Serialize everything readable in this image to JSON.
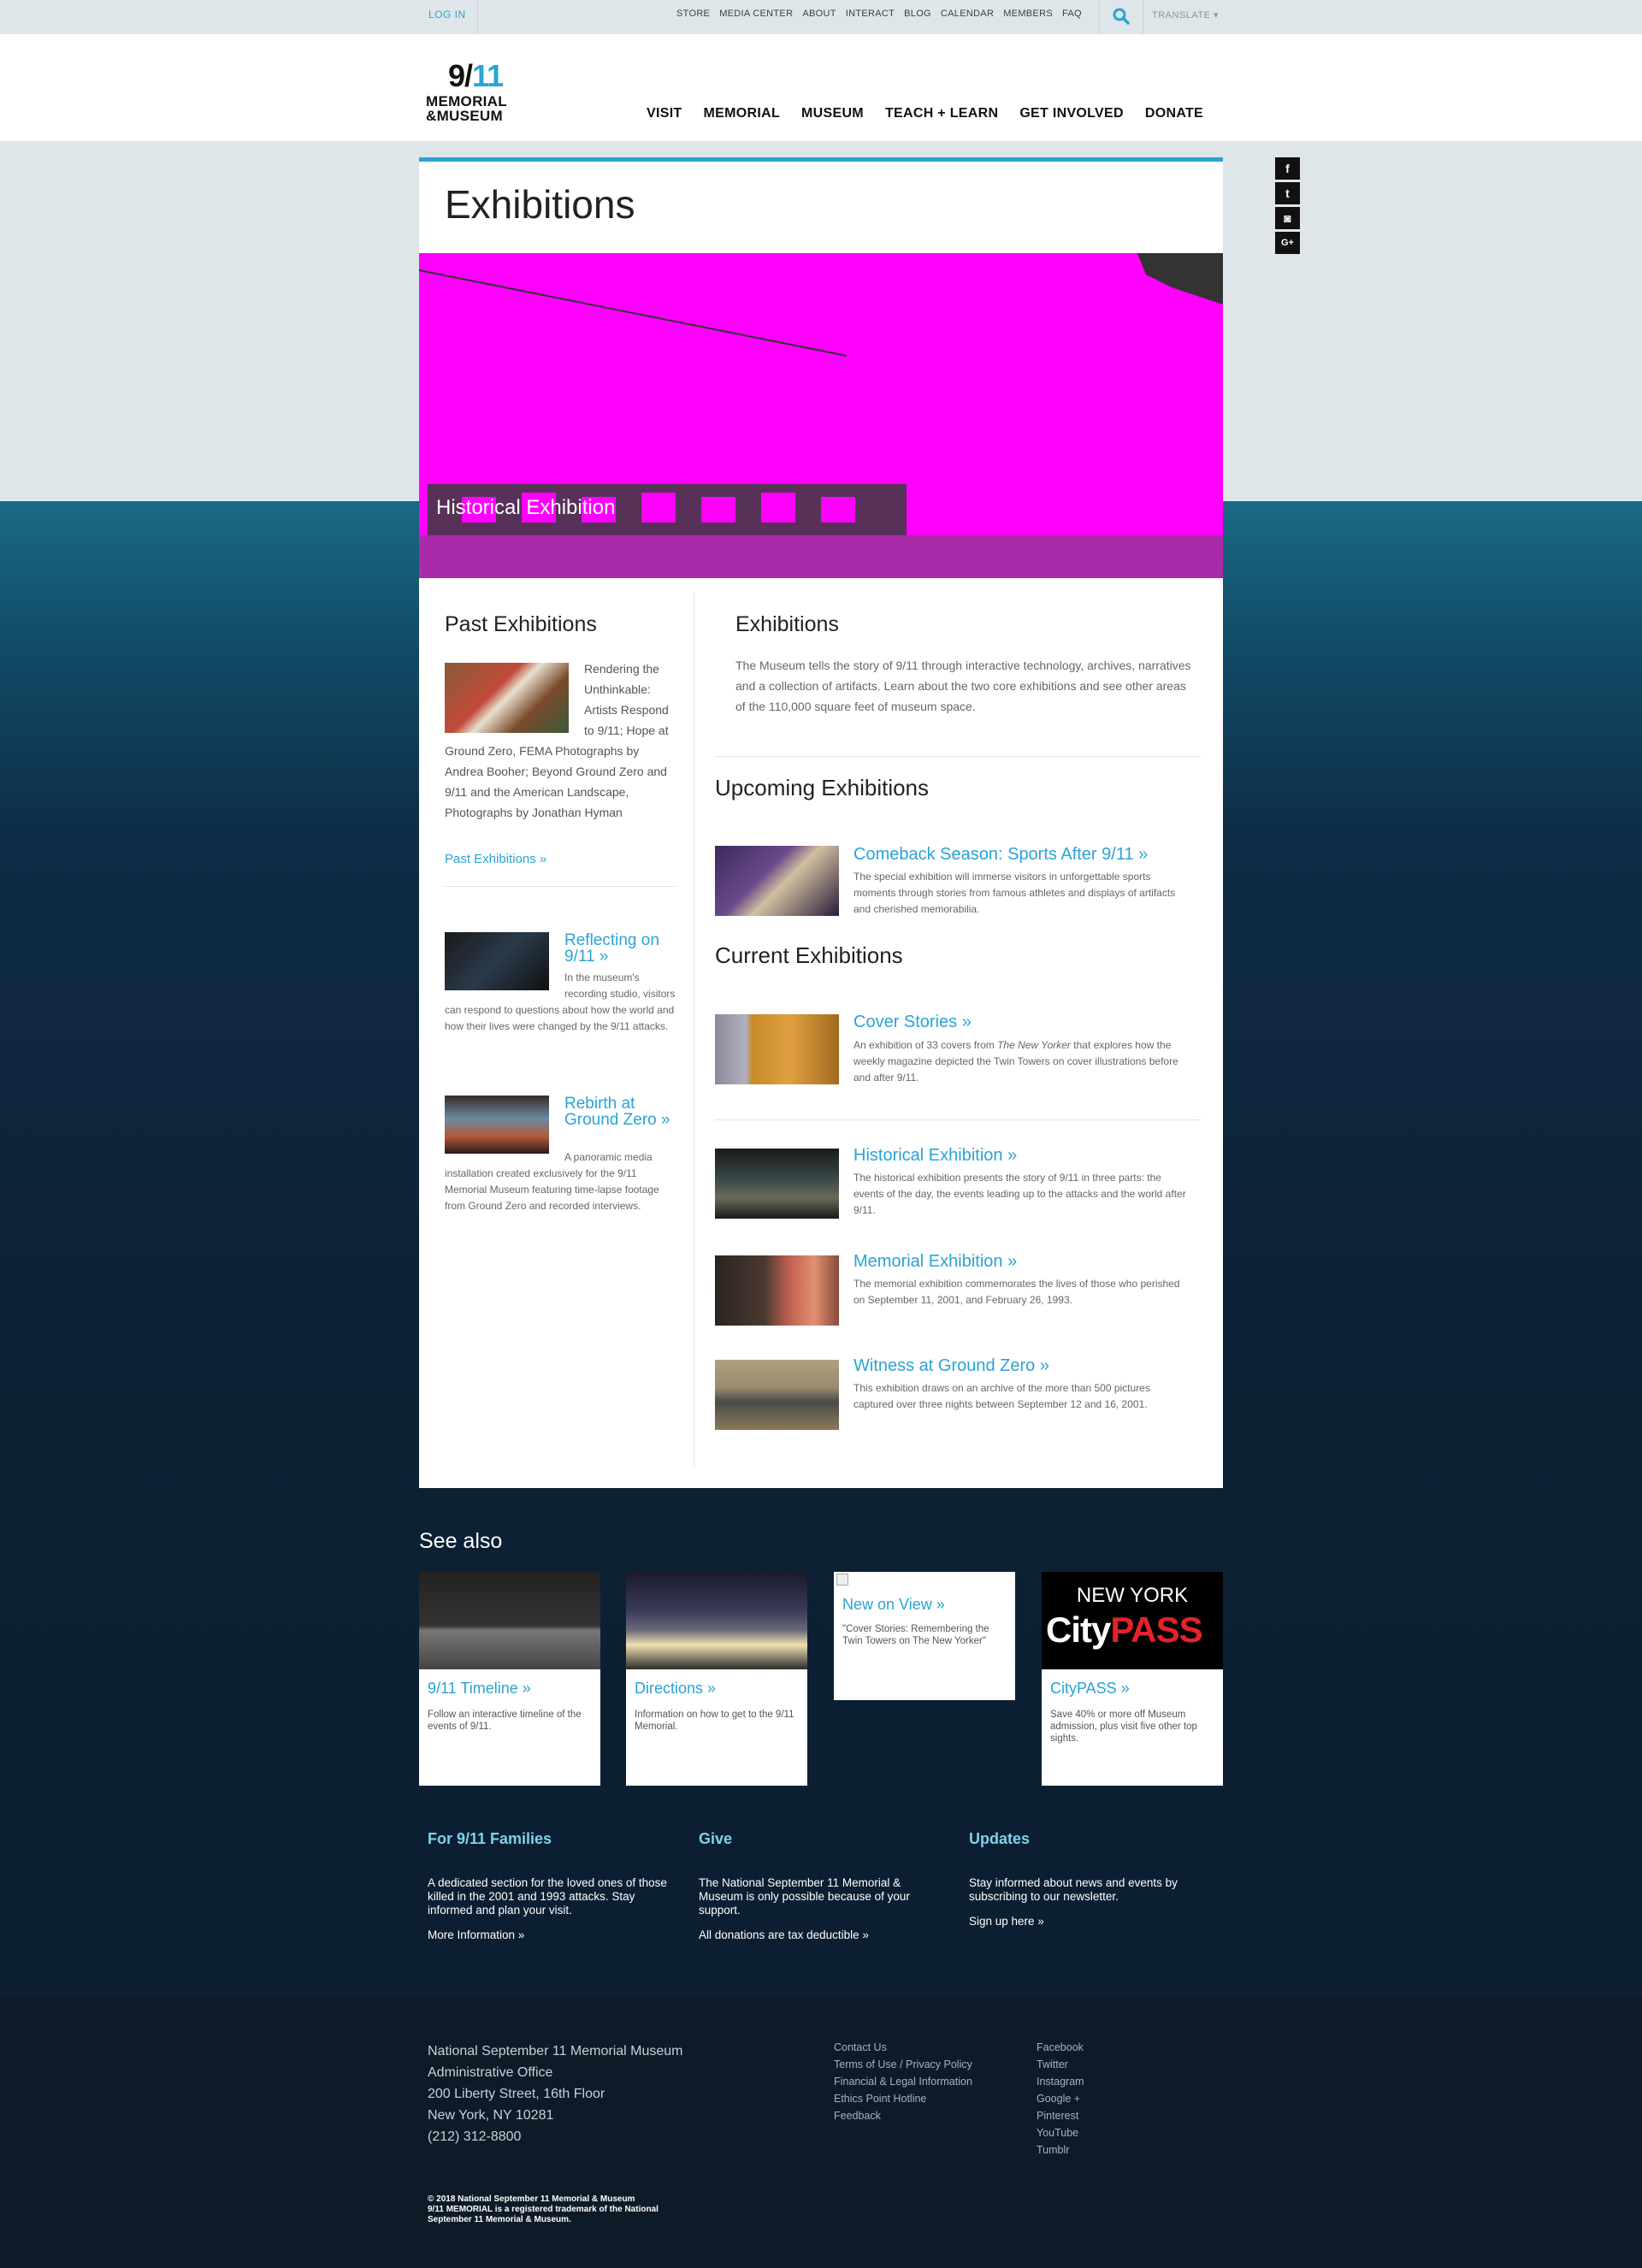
{
  "utility": {
    "login": "LOG IN",
    "links": [
      "STORE",
      "MEDIA CENTER",
      "ABOUT",
      "INTERACT",
      "BLOG",
      "CALENDAR",
      "MEMBERS",
      "FAQ"
    ],
    "translate": "TRANSLATE ▾"
  },
  "logo": {
    "nine": "9/",
    "eleven": "11",
    "line1": "MEMORIAL",
    "line2": "&MUSEUM"
  },
  "nav": [
    "VISIT",
    "MEMORIAL",
    "MUSEUM",
    "TEACH + LEARN",
    "GET INVOLVED",
    "DONATE"
  ],
  "social": [
    {
      "icon": "facebook-icon",
      "glyph": "f"
    },
    {
      "icon": "twitter-icon",
      "glyph": "t"
    },
    {
      "icon": "instagram-icon",
      "glyph": "◙"
    },
    {
      "icon": "googleplus-icon",
      "glyph": "G+"
    }
  ],
  "page_title": "Exhibitions",
  "hero_caption": "Historical Exhibition",
  "past": {
    "title": "Past Exhibitions",
    "text": "Rendering the Unthinkable: Artists Respond to 9/11; Hope at Ground Zero, FEMA Photographs by Andrea Booher; Beyond Ground Zero and 9/11 and the American Landscape, Photographs by Jonathan Hyman",
    "link": "Past Exhibitions »"
  },
  "side_items": [
    {
      "title": "Reflecting on 9/11 »",
      "text": "In the museum's recording studio, visitors can respond to questions about how the world and how their lives were changed by the 9/11 attacks."
    },
    {
      "title": "Rebirth at Ground Zero »",
      "text": "A panoramic media installation created exclusively for the 9/11 Memorial Museum featuring time-lapse footage from Ground Zero and recorded interviews."
    }
  ],
  "intro": {
    "title": "Exhibitions",
    "text": "The Museum tells the story of 9/11 through interactive technology, archives, narratives and a collection of artifacts. Learn about the two core exhibitions and see other areas of the 110,000 square feet of museum space."
  },
  "upcoming": {
    "title": "Upcoming Exhibitions",
    "items": [
      {
        "title": "Comeback Season: Sports After 9/11 »",
        "text": "The special exhibition will immerse visitors in unforgettable sports moments through stories from famous athletes and displays of artifacts and cherished memorabilia."
      }
    ]
  },
  "current": {
    "title": "Current Exhibitions",
    "cover": {
      "title": "Cover Stories »",
      "text_pre": "An exhibition of 33 covers from ",
      "text_em": "The New Yorker",
      "text_post": " that explores how the weekly magazine depicted the Twin Towers on cover illustrations before and after 9/11."
    },
    "items": [
      {
        "title": "Historical Exhibition »",
        "text": "The historical exhibition presents the story of 9/11 in three parts: the events of the day, the events leading up to the attacks and the world after 9/11."
      },
      {
        "title": "Memorial Exhibition »",
        "text": "The memorial exhibition commemorates the lives of those who perished on September 11, 2001, and February 26, 1993."
      },
      {
        "title": "Witness at Ground Zero »",
        "text": "This exhibition draws on an archive of the more than 500 pictures captured over three nights between September 12 and 16, 2001."
      }
    ]
  },
  "see_also": {
    "title": "See also",
    "cards": [
      {
        "title": "9/11 Timeline »",
        "text": "Follow an interactive timeline of the events of 9/11."
      },
      {
        "title": "Directions »",
        "text": "Information on how to get to the 9/11 Memorial."
      },
      {
        "title": "New on View »",
        "text": "\"Cover Stories: Remembering the Twin Towers on The New Yorker\""
      },
      {
        "title": "CityPASS »",
        "text": "Save 40% or more off Museum admission, plus visit five other top sights.",
        "logo_top": "NEW YORK",
        "logo_city": "City",
        "logo_pass": "PASS"
      }
    ]
  },
  "promos": [
    {
      "title": "For 9/11 Families",
      "text": "A dedicated section for the loved ones of those killed in the 2001 and 1993 attacks. Stay informed and plan your visit.",
      "link": "More Information »"
    },
    {
      "title": "Give",
      "text": "The National September 11 Memorial & Museum is only possible because of your support.",
      "link": "All donations are tax deductible »"
    },
    {
      "title": "Updates",
      "text": "Stay informed about news and events by subscribing to our newsletter.",
      "link": "Sign up here »"
    }
  ],
  "footer": {
    "address": [
      "National September 11 Memorial Museum",
      "Administrative Office",
      "200 Liberty Street, 16th Floor",
      "New York, NY 10281",
      "(212) 312-8800"
    ],
    "links1": [
      "Contact Us",
      "Terms of Use / Privacy Policy",
      "Financial & Legal Information",
      "Ethics Point Hotline",
      "Feedback"
    ],
    "links2": [
      "Facebook",
      "Twitter",
      "Instagram",
      "Google +",
      "Pinterest",
      "YouTube",
      "Tumblr"
    ],
    "copyright": "© 2018 National September 11 Memorial & Museum",
    "trademark": "9/11 MEMORIAL is a registered trademark of the National September 11 Memorial & Museum."
  },
  "colors": {
    "accent": "#2aa3d4",
    "hero": "#ff00ff",
    "dark": "#0d1a28"
  }
}
